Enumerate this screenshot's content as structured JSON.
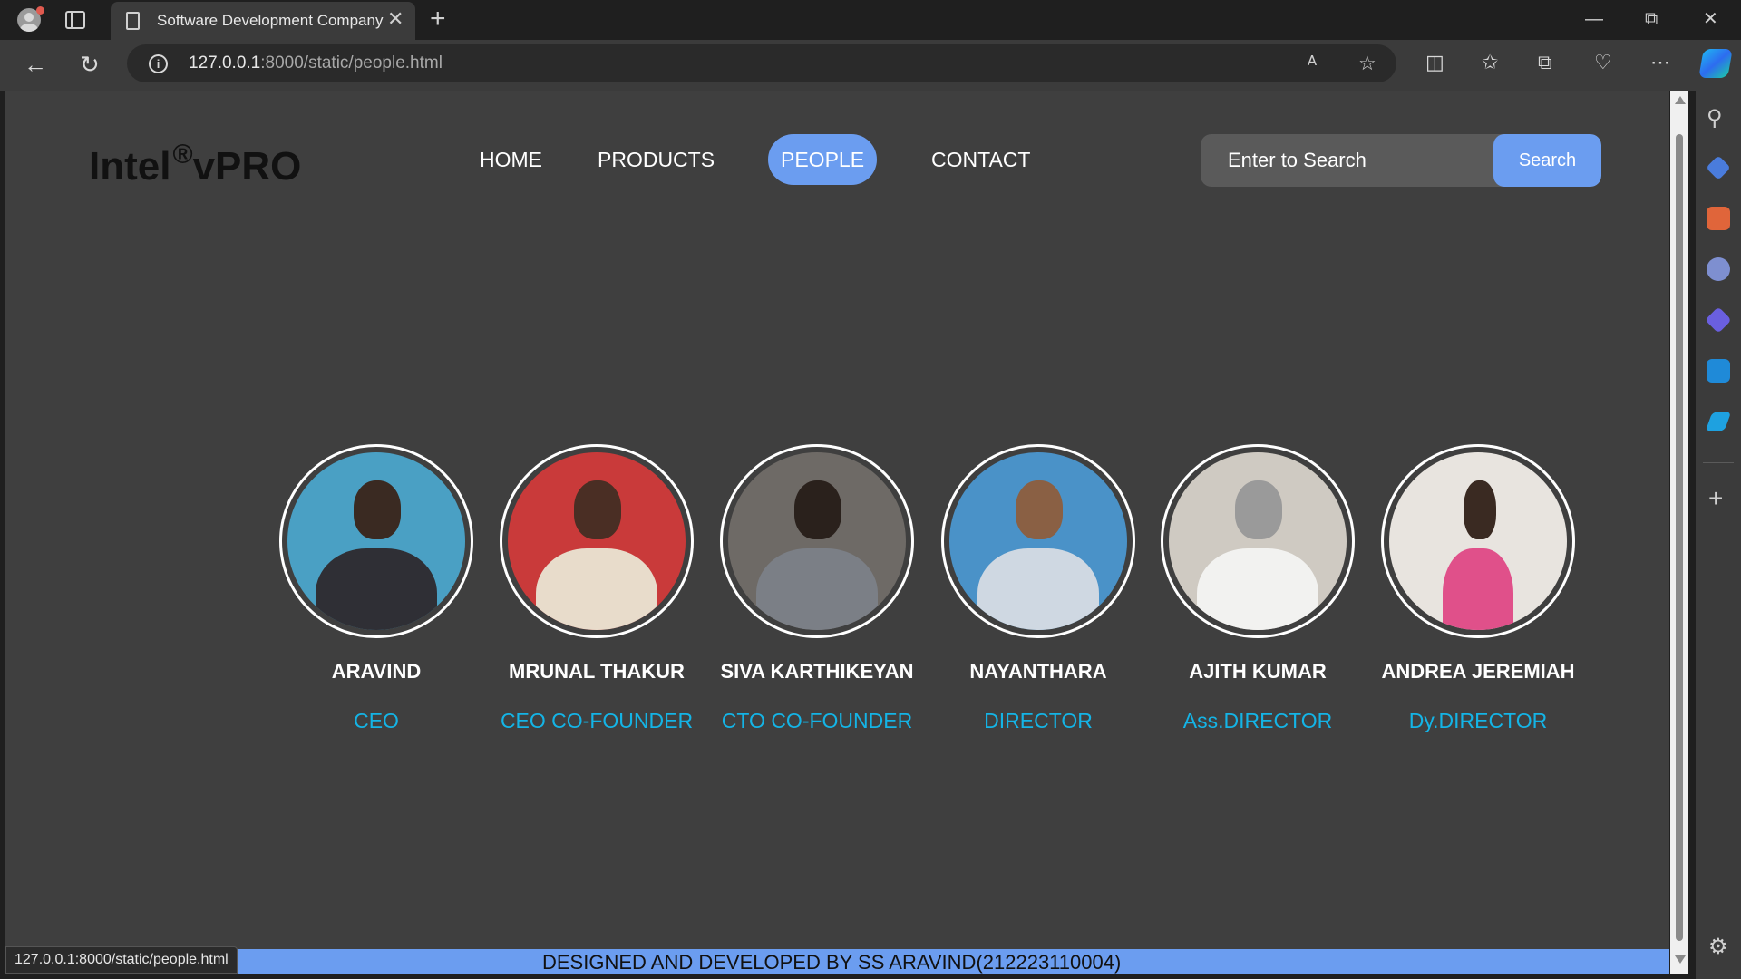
{
  "browser": {
    "tab_title": "Software Development Company",
    "url_host": "127.0.0.1",
    "url_rest": ":8000/static/people.html",
    "status_url": "127.0.0.1:8000/static/people.html",
    "new_tab_glyph": "+",
    "close_glyph": "✕"
  },
  "site": {
    "logo_text": "Intel",
    "logo_mark": "®",
    "logo_suffix": "vPRO",
    "nav": [
      {
        "label": "HOME",
        "active": false
      },
      {
        "label": "PRODUCTS",
        "active": false
      },
      {
        "label": "PEOPLE",
        "active": true
      },
      {
        "label": "CONTACT",
        "active": false
      }
    ],
    "search": {
      "placeholder": "Enter to Search",
      "button": "Search"
    },
    "people": [
      {
        "name": "ARAVIND",
        "role": "CEO"
      },
      {
        "name": "MRUNAL THAKUR",
        "role": "CEO CO-FOUNDER"
      },
      {
        "name": "SIVA KARTHIKEYAN",
        "role": "CTO CO-FOUNDER"
      },
      {
        "name": "NAYANTHARA",
        "role": "DIRECTOR"
      },
      {
        "name": "AJITH KUMAR",
        "role": "Ass.DIRECTOR"
      },
      {
        "name": "ANDREA JEREMIAH",
        "role": "Dy.DIRECTOR"
      }
    ],
    "footer": "DESIGNED AND DEVELOPED BY SS ARAVIND(212223110004)"
  },
  "colors": {
    "accent": "#6b9df0",
    "role_text": "#14b4e6",
    "page_bg": "#3f3f3f"
  }
}
